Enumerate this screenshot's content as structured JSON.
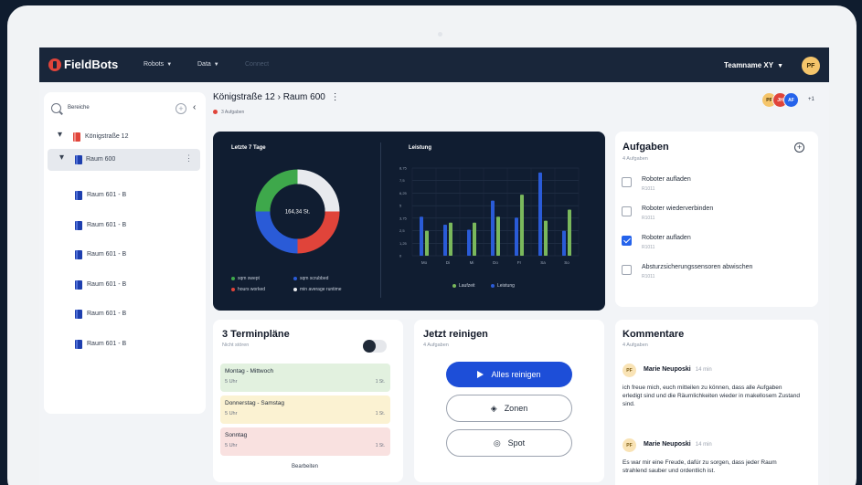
{
  "app": {
    "brand": "FieldBots"
  },
  "nav": {
    "items": [
      {
        "label": "Robots",
        "chevron": "chevron-down-icon"
      },
      {
        "label": "Data",
        "chevron": "chevron-down-icon"
      },
      {
        "label": "Connect"
      }
    ],
    "team": "Teamname XY",
    "user_initials": "PF"
  },
  "sidebar": {
    "search_label": "Bereiche",
    "tree": [
      {
        "label": "Königstraße 12",
        "level": 0,
        "expanded": true
      },
      {
        "label": "Raum 600",
        "level": 1,
        "expanded": true,
        "selected": true
      },
      {
        "label": "Raum 601 - B",
        "level": 2
      },
      {
        "label": "Raum 601 - B",
        "level": 2
      },
      {
        "label": "Raum 601 - B",
        "level": 2
      },
      {
        "label": "Raum 601 - B",
        "level": 2
      },
      {
        "label": "Raum 601 - B",
        "level": 2
      },
      {
        "label": "Raum 601 - B",
        "level": 2
      }
    ]
  },
  "header": {
    "breadcrumb": "Königstraße 12 › Raum 600",
    "subtitle": "3 Aufgaben",
    "collaborators": [
      {
        "initials": "PF",
        "color": "#f5c56b"
      },
      {
        "initials": "JH",
        "color": "#e0443a"
      },
      {
        "initials": "AF",
        "color": "#2563eb"
      }
    ],
    "more_count": "+1"
  },
  "colors": {
    "green": "#3ea84b",
    "red": "#e0443a",
    "blue": "#2a5bd7",
    "white": "#e8eaee",
    "bar_blue": "#2a5bd7",
    "bar_green": "#7ab85c"
  },
  "chart_data": [
    {
      "type": "pie",
      "title": "Letzte 7 Tage",
      "center_label": "164,34 St.",
      "slices": [
        {
          "label": "sqm swept",
          "value": 25,
          "color": "#3ea84b"
        },
        {
          "label": "hours worked",
          "value": 25,
          "color": "#e0443a"
        },
        {
          "label": "sqm scrubbed",
          "value": 25,
          "color": "#2a5bd7"
        },
        {
          "label": "min average runtime",
          "value": 25,
          "color": "#e8eaee"
        }
      ],
      "legend": [
        "sqm swept",
        "sqm scrubbed",
        "hours worked",
        "min average runtime"
      ]
    },
    {
      "type": "bar",
      "title": "Leistung",
      "categories": [
        "Mo",
        "Di",
        "Mi",
        "Do",
        "Fr",
        "Sa",
        "So"
      ],
      "yticks": [
        "8,75",
        "7,5",
        "6,25",
        "5",
        "3,75",
        "2,5",
        "1,25",
        "0"
      ],
      "ylim": [
        0,
        8.75
      ],
      "series": [
        {
          "name": "Leistung",
          "color": "#2a5bd7",
          "values": [
            3.9,
            3.1,
            2.6,
            5.5,
            3.8,
            8.3,
            2.5
          ]
        },
        {
          "name": "Laufzeit",
          "color": "#7ab85c",
          "values": [
            2.5,
            3.3,
            3.3,
            3.9,
            6.1,
            3.5,
            4.6
          ]
        }
      ],
      "legend": [
        "Laufzeit",
        "Leistung"
      ]
    }
  ],
  "tasks": {
    "title": "Aufgaben",
    "subtitle": "4 Aufgaben",
    "items": [
      {
        "label": "Roboter aufladen",
        "code": "R1011",
        "checked": false
      },
      {
        "label": "Roboter wiederverbinden",
        "code": "R1011",
        "checked": false
      },
      {
        "label": "Roboter aufladen",
        "code": "R1011",
        "checked": true
      },
      {
        "label": "Absturzsicherungssensoren abwischen",
        "code": "R1011",
        "checked": false
      }
    ]
  },
  "schedules": {
    "title": "3 Terminpläne",
    "subtitle": "Nicht stören",
    "toggle_on": false,
    "items": [
      {
        "label": "Montag - Mittwoch",
        "time": "5 Uhr",
        "duration": "1 St.",
        "color": "#e2f1df"
      },
      {
        "label": "Donnerstag - Samstag",
        "time": "5 Uhr",
        "duration": "1 St.",
        "color": "#fbf2d2"
      },
      {
        "label": "Sonntag",
        "time": "5 Uhr",
        "duration": "1 St.",
        "color": "#f9e1e0"
      }
    ],
    "edit_label": "Bearbeiten"
  },
  "clean_now": {
    "title": "Jetzt reinigen",
    "subtitle": "4 Aufgaben",
    "primary": "Alles reinigen",
    "zones": "Zonen",
    "spot": "Spot"
  },
  "comments": {
    "title": "Kommentare",
    "subtitle": "4 Aufgaben",
    "items": [
      {
        "initials": "PF",
        "author": "Marie Neuposki",
        "time": "14 min",
        "text": "ich freue mich, euch mitteilen zu können, dass alle Aufgaben erledigt sind und die Räumlichkeiten wieder in makellosem Zustand sind."
      },
      {
        "initials": "PF",
        "author": "Marie Neuposki",
        "time": "14 min",
        "text": "Es war mir eine Freude, dafür zu sorgen, dass jeder Raum strahlend sauber und ordentlich ist."
      }
    ]
  }
}
